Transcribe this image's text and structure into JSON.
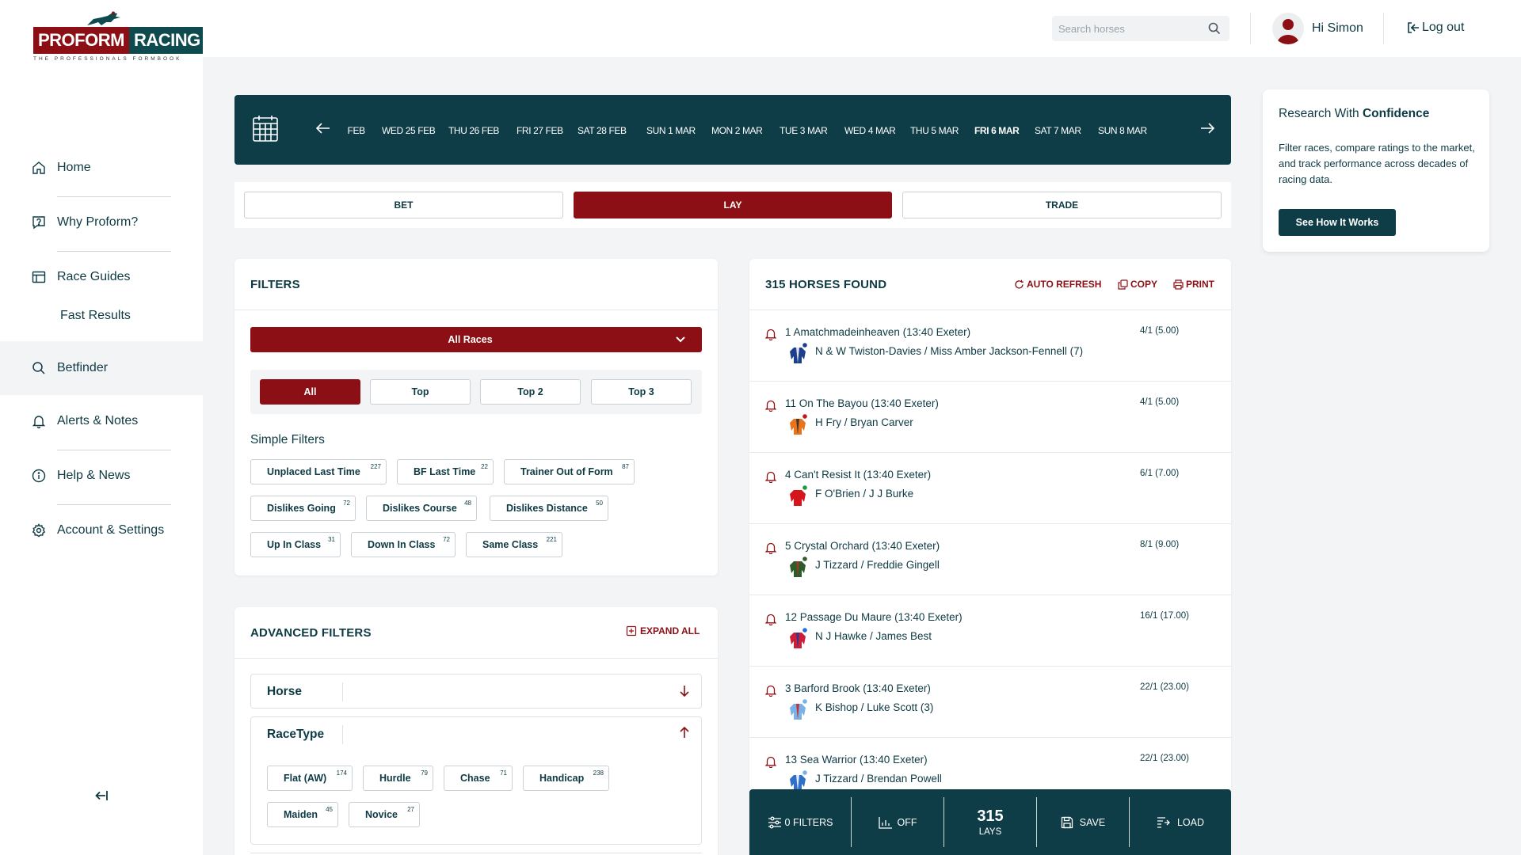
{
  "brand": {
    "name_left": "PROFORM",
    "name_right": "RACING",
    "tagline": "THE PROFESSIONALS FORMBOOK"
  },
  "colors": {
    "primary_red": "#8b0f14",
    "primary_teal": "#0e3c47",
    "text_dark": "#0e3a44"
  },
  "sidebar": {
    "items": [
      {
        "label": "Home",
        "icon": "home-icon"
      },
      {
        "label": "Why Proform?",
        "icon": "question-icon"
      },
      {
        "label": "Race Guides",
        "icon": "table-icon"
      },
      {
        "label": "Fast Results",
        "icon": ""
      },
      {
        "label": "Betfinder",
        "icon": "search-icon"
      },
      {
        "label": "Alerts & Notes",
        "icon": "bell-icon"
      },
      {
        "label": "Help & News",
        "icon": "info-icon"
      },
      {
        "label": "Account & Settings",
        "icon": "gear-icon"
      }
    ],
    "collapse_icon": "collapse-icon"
  },
  "header": {
    "search_placeholder": "Search horses",
    "greeting": "Hi Simon",
    "logout": "Log out"
  },
  "dates": {
    "items": [
      "‹ FEB",
      "WED 25 FEB",
      "THU 26 FEB",
      "FRI 27 FEB",
      "SAT 28 FEB",
      "SUN 1 MAR",
      "MON 2 MAR",
      "TUE 3 MAR",
      "WED 4 MAR",
      "THU 5 MAR",
      "FRI 6 MAR",
      "SAT 7 MAR",
      "SUN 8 MAR"
    ],
    "selected": "FRI 6 MAR"
  },
  "modes": {
    "bet": "BET",
    "lay": "LAY",
    "trade": "TRADE",
    "active": "LAY"
  },
  "filters": {
    "title": "FILTERS",
    "race_select": "All Races",
    "segments": [
      "All",
      "Top",
      "Top 2",
      "Top 3"
    ],
    "active_segment": "All",
    "simple_title": "Simple Filters",
    "simple": [
      {
        "label": "Unplaced Last Time",
        "count": "227"
      },
      {
        "label": "BF Last Time",
        "count": "22"
      },
      {
        "label": "Trainer Out of Form",
        "count": "87"
      },
      {
        "label": "Dislikes Going",
        "count": "72"
      },
      {
        "label": "Dislikes Course",
        "count": "48"
      },
      {
        "label": "Dislikes Distance",
        "count": "50"
      },
      {
        "label": "Up In Class",
        "count": "31"
      },
      {
        "label": "Down In Class",
        "count": "72"
      },
      {
        "label": "Same Class",
        "count": "221"
      }
    ]
  },
  "advanced": {
    "title": "ADVANCED FILTERS",
    "expand_all": "EXPAND ALL",
    "horse_label": "Horse",
    "racetype_label": "RaceType",
    "racetypes": [
      {
        "label": "Flat (AW)",
        "count": "174"
      },
      {
        "label": "Hurdle",
        "count": "79"
      },
      {
        "label": "Chase",
        "count": "71"
      },
      {
        "label": "Handicap",
        "count": "238"
      },
      {
        "label": "Maiden",
        "count": "45"
      },
      {
        "label": "Novice",
        "count": "27"
      }
    ]
  },
  "results": {
    "title": "315 HORSES FOUND",
    "auto_refresh": "AUTO REFRESH",
    "copy": "COPY",
    "print": "PRINT",
    "horses": [
      {
        "title": "1 Amatchmadeinheaven (13:40 Exeter)",
        "sub": "N & W Twiston-Davies / Miss Amber Jackson-Fennell (7)",
        "odds": "4/1 (5.00)",
        "silk_main": "#1c3f8c",
        "silk_accent": "#ffffff",
        "cap": "#1c3f8c"
      },
      {
        "title": "11 On The Bayou (13:40 Exeter)",
        "sub": "H Fry / Bryan Carver",
        "odds": "4/1 (5.00)",
        "silk_main": "#e8741c",
        "silk_accent": "#2a2a2a",
        "cap": "#c0181e"
      },
      {
        "title": "4 Can't Resist It (13:40 Exeter)",
        "sub": "F O'Brien / J J Burke",
        "odds": "6/1 (7.00)",
        "silk_main": "#d4161c",
        "silk_accent": "#d4161c",
        "cap": "#1f9a3a"
      },
      {
        "title": "5 Crystal Orchard (13:40 Exeter)",
        "sub": "J Tizzard / Freddie Gingell",
        "odds": "8/1 (9.00)",
        "silk_main": "#2e5b2a",
        "silk_accent": "#a8342c",
        "cap": "#2e5b2a"
      },
      {
        "title": "12 Passage Du Maure (13:40 Exeter)",
        "sub": "N J Hawke / James Best",
        "odds": "16/1 (17.00)",
        "silk_main": "#c81f3a",
        "silk_accent": "#1f3a9a",
        "cap": "#1f6fd4"
      },
      {
        "title": "3 Barford Brook (13:40 Exeter)",
        "sub": "K Bishop / Luke Scott (3)",
        "odds": "22/1 (23.00)",
        "silk_main": "#7ab2e8",
        "silk_accent": "#c8201e",
        "cap": "#7ab2e8"
      },
      {
        "title": "13 Sea Warrior (13:40 Exeter)",
        "sub": "J Tizzard / Brendan Powell",
        "odds": "22/1 (23.00)",
        "silk_main": "#2e6fc8",
        "silk_accent": "#ffffff",
        "cap": "#7ab2e8"
      }
    ]
  },
  "bottom_bar": {
    "filters": "0 FILTERS",
    "off": "OFF",
    "count": "315",
    "count_label": "LAYS",
    "save": "SAVE",
    "load": "LOAD"
  },
  "info": {
    "title_plain": "Research With ",
    "title_bold": "Confidence",
    "body": "Filter races, compare ratings to the market, and track performance across decades of racing data.",
    "cta": "See How It Works"
  }
}
